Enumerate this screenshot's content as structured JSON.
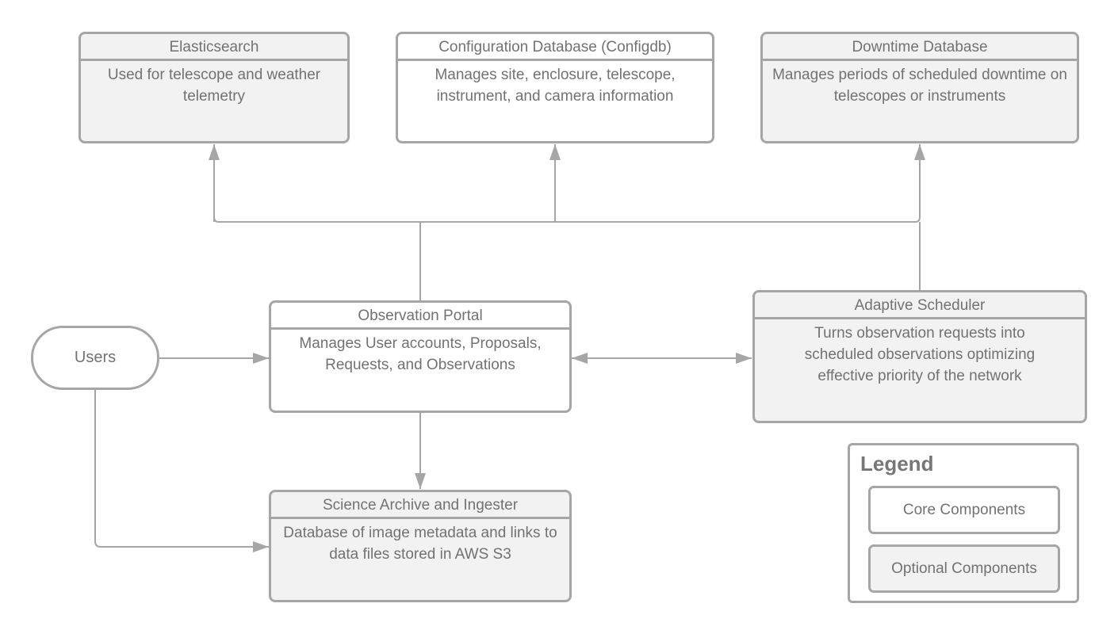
{
  "diagram": {
    "nodes": {
      "elasticsearch": {
        "title": "Elasticsearch",
        "description": "Used for telescope and weather telemetry",
        "kind": "optional"
      },
      "configdb": {
        "title": "Configuration Database (Configdb)",
        "description": "Manages site, enclosure, telescope, instrument, and camera information",
        "kind": "core"
      },
      "downtimedb": {
        "title": "Downtime Database",
        "description": "Manages periods of scheduled downtime on telescopes or instruments",
        "kind": "optional"
      },
      "users": {
        "label": "Users"
      },
      "observation_portal": {
        "title": "Observation Portal",
        "description": "Manages User accounts, Proposals, Requests, and Observations",
        "kind": "core"
      },
      "adaptive_scheduler": {
        "title": "Adaptive Scheduler",
        "description": "Turns observation requests into scheduled observations optimizing effective priority of the network",
        "kind": "optional"
      },
      "science_archive": {
        "title": "Science Archive and Ingester",
        "description": "Database of image metadata and links to data files stored in AWS S3",
        "kind": "optional"
      }
    },
    "edges": [
      {
        "from": "observation_portal",
        "to": "elasticsearch",
        "direction": "forward"
      },
      {
        "from": "observation_portal",
        "to": "configdb",
        "direction": "forward"
      },
      {
        "from": "observation_portal",
        "to": "downtimedb",
        "direction": "forward"
      },
      {
        "from": "adaptive_scheduler",
        "to": "elasticsearch",
        "direction": "forward"
      },
      {
        "from": "adaptive_scheduler",
        "to": "configdb",
        "direction": "forward"
      },
      {
        "from": "adaptive_scheduler",
        "to": "downtimedb",
        "direction": "forward"
      },
      {
        "from": "users",
        "to": "observation_portal",
        "direction": "forward"
      },
      {
        "from": "observation_portal",
        "to": "adaptive_scheduler",
        "direction": "both"
      },
      {
        "from": "observation_portal",
        "to": "science_archive",
        "direction": "forward"
      },
      {
        "from": "users",
        "to": "science_archive",
        "direction": "forward"
      }
    ],
    "colors": {
      "stroke": "#a6a6a6",
      "text": "#727272",
      "core_fill": "#ffffff",
      "optional_fill": "#f2f2f2"
    }
  },
  "legend": {
    "title": "Legend",
    "items": [
      {
        "label": "Core Components",
        "kind": "core"
      },
      {
        "label": "Optional Components",
        "kind": "optional"
      }
    ]
  }
}
